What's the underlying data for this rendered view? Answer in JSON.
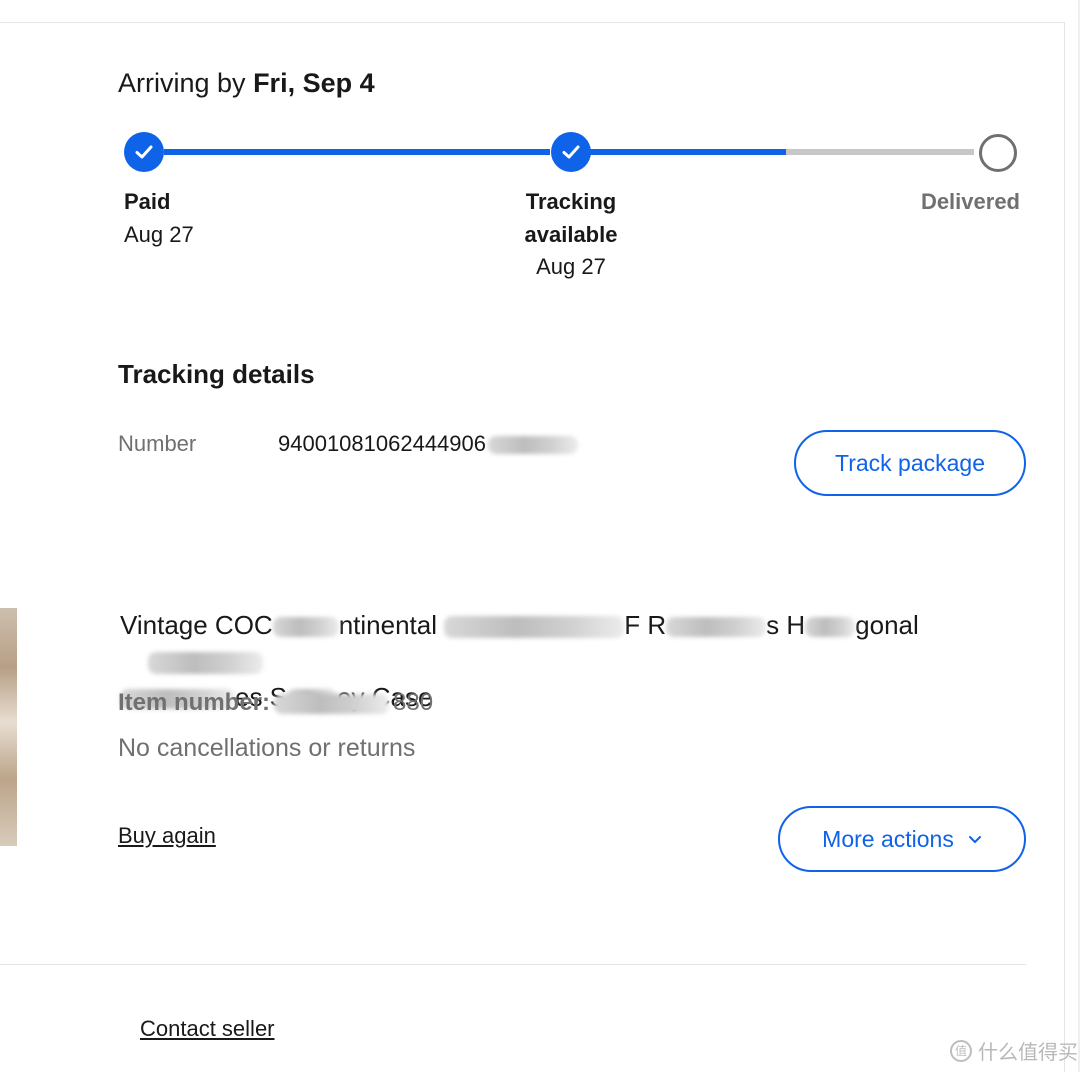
{
  "delivery": {
    "arriving_prefix": "Arriving by",
    "arriving_date": "Fri, Sep 4"
  },
  "progress": {
    "steps": [
      {
        "label": "Paid",
        "date": "Aug 27",
        "state": "complete"
      },
      {
        "label": "Tracking available",
        "date": "Aug 27",
        "state": "complete"
      },
      {
        "label": "Delivered",
        "date": "",
        "state": "pending"
      }
    ],
    "colors": {
      "complete": "#0f63e8",
      "pending": "#c7c7c7"
    }
  },
  "tracking": {
    "title": "Tracking details",
    "number_label": "Number",
    "number_value": "940010810624449​06",
    "track_button": "Track package"
  },
  "item": {
    "title_part1": "Vintage COC",
    "title_part2": "ntinental",
    "title_part3": "F R",
    "title_part4": "s H",
    "title_part5": "gonal",
    "title_part6": "es S",
    "title_part7": "ey Case",
    "number_label": "Item number:",
    "number_suffix": "880",
    "policy": "No cancellations or returns",
    "buy_again": "Buy again",
    "more_actions": "More actions"
  },
  "footer": {
    "contact_seller": "Contact seller"
  },
  "watermark": {
    "text": "什么值得买"
  }
}
